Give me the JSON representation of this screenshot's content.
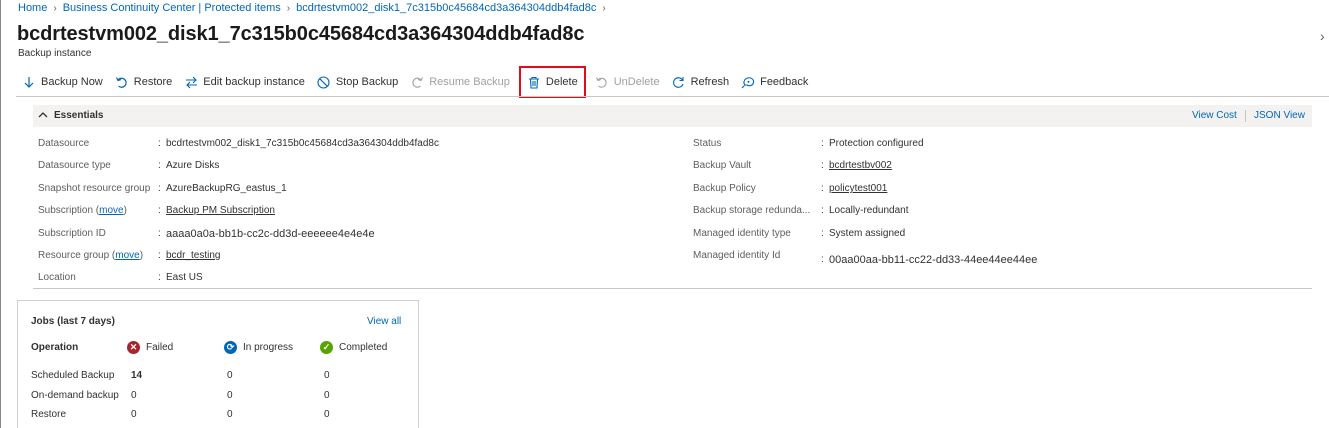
{
  "breadcrumb": {
    "items": [
      "Home",
      "Business Continuity Center | Protected items",
      "bcdrtestvm002_disk1_7c315b0c45684cd3a364304ddb4fad8c"
    ],
    "more": "…"
  },
  "header": {
    "title": "bcdrtestvm002_disk1_7c315b0c45684cd3a364304ddb4fad8c",
    "subtitle": "Backup instance",
    "more": "···",
    "chevron": "›"
  },
  "toolbar": {
    "backup_now": "Backup Now",
    "restore": "Restore",
    "edit_backup_instance": "Edit backup instance",
    "stop_backup": "Stop Backup",
    "resume_backup": "Resume Backup",
    "delete": "Delete",
    "undelete": "UnDelete",
    "refresh": "Refresh",
    "feedback": "Feedback"
  },
  "essentials": {
    "title": "Essentials",
    "view_cost": "View Cost",
    "json_view": "JSON View",
    "left": [
      {
        "label": "Datasource",
        "value": "bcdrtestvm002_disk1_7c315b0c45684cd3a364304ddb4fad8c"
      },
      {
        "label": "Datasource type",
        "value": "Azure Disks"
      },
      {
        "label": "Snapshot resource group",
        "value": "AzureBackupRG_eastus_1"
      },
      {
        "label": "Subscription",
        "move": "move",
        "value": "Backup PM Subscription"
      },
      {
        "label": "Subscription ID",
        "value": "aaaa0a0a-bb1b-cc2c-dd3d-eeeeee4e4e4e"
      },
      {
        "label": "Resource group",
        "move": "move",
        "value": "bcdr_testing"
      },
      {
        "label": "Location",
        "value": "East US"
      }
    ],
    "right": [
      {
        "label": "Status",
        "value": "Protection configured"
      },
      {
        "label": "Backup Vault",
        "value": "bcdrtestbv002"
      },
      {
        "label": "Backup Policy",
        "value": "policytest001"
      },
      {
        "label": "Backup storage redunda...",
        "value": "Locally-redundant"
      },
      {
        "label": "Managed identity type",
        "value": "System assigned"
      },
      {
        "label": "Managed identity Id",
        "value": "00aa00aa-bb11-cc22-dd33-44ee44ee44ee"
      }
    ]
  },
  "jobs": {
    "title": "Jobs (last 7 days)",
    "view_all": "View all",
    "headers": {
      "operation": "Operation",
      "failed": "Failed",
      "in_progress": "In progress",
      "completed": "Completed"
    },
    "rows": [
      {
        "operation": "Scheduled Backup",
        "failed": "14",
        "in_progress": "0",
        "completed": "0"
      },
      {
        "operation": "On-demand backup",
        "failed": "0",
        "in_progress": "0",
        "completed": "0"
      },
      {
        "operation": "Restore",
        "failed": "0",
        "in_progress": "0",
        "completed": "0"
      }
    ]
  },
  "colors": {
    "link": "#0067b8",
    "delete_highlight": "#e00b1c",
    "failed": "#a4262c",
    "in_progress": "#0067b8",
    "completed": "#57a300"
  }
}
